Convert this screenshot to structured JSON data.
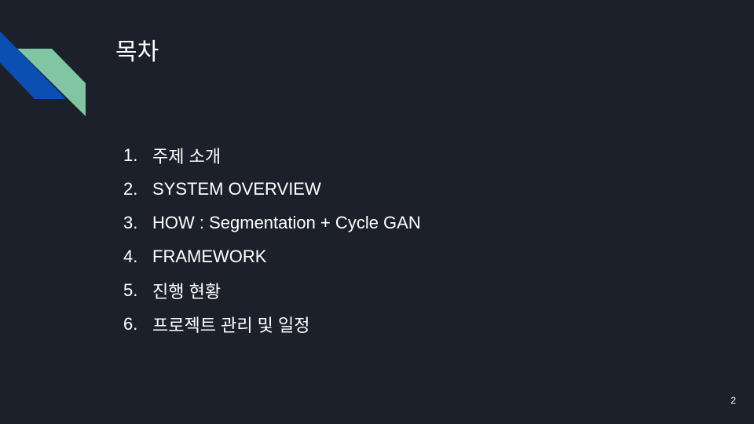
{
  "slide": {
    "title": "목차",
    "items": [
      {
        "number": "1.",
        "text": "주제 소개"
      },
      {
        "number": "2.",
        "text": "SYSTEM OVERVIEW"
      },
      {
        "number": "3.",
        "text": "HOW : Segmentation + Cycle GAN"
      },
      {
        "number": "4.",
        "text": "FRAMEWORK"
      },
      {
        "number": "5.",
        "text": "진행 현황"
      },
      {
        "number": "6.",
        "text": "프로젝트 관리 및 일정"
      }
    ],
    "page_number": "2"
  },
  "colors": {
    "background": "#1c202b",
    "accent_blue": "#0b4fb4",
    "accent_green": "#80c6a2",
    "text": "#ffffff"
  }
}
